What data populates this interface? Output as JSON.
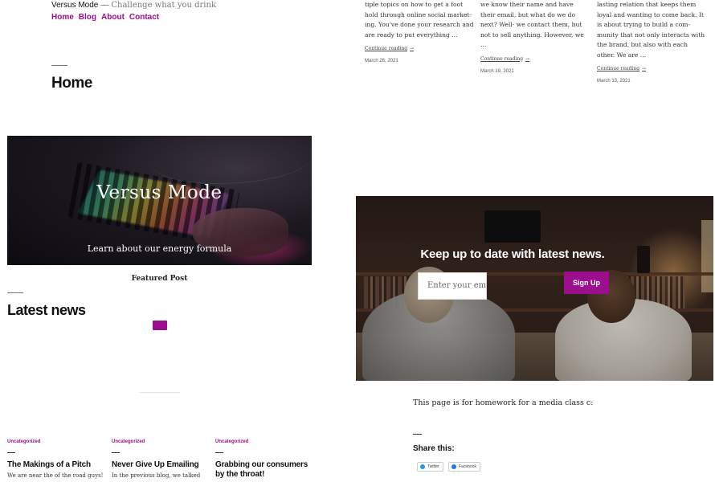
{
  "site": {
    "name": "Versus Mode",
    "dash": "—",
    "tagline": "Challenge what you drink"
  },
  "nav": {
    "items": [
      "Home",
      "Blog",
      "About",
      "Contact"
    ]
  },
  "page": {
    "title": "Home"
  },
  "hero": {
    "title": "Versus Mode",
    "subtitle": "Learn about our energy formula",
    "caption": "Featured Post"
  },
  "latest": {
    "title": "Latest news",
    "cards": [
      {
        "category": "Uncategorized",
        "title": "The Makings of a Pitch",
        "excerpt": "We are near the of the road guys!"
      },
      {
        "category": "Uncategorized",
        "title": "Never Give Up Emailing",
        "excerpt": "In the previous blog, we talked"
      },
      {
        "category": "Uncategorized",
        "title": "Grabbing our consumers by the throat!",
        "excerpt": ""
      }
    ]
  },
  "posts": [
    {
      "lines": [
        "tiple topics on how to get a foot",
        "hold through online social market-",
        "ing. You've done your research and",
        "are ready to put everything ..."
      ],
      "more": "Continue reading",
      "arrow": "→",
      "date": "March 26, 2021"
    },
    {
      "lines": [
        "we know their name and have",
        "their email, but what do we do",
        "next? Well- we contact them, but",
        "not to sell anything. However, we",
        "..."
      ],
      "more": "Continue reading",
      "arrow": "→",
      "date": "March 19, 2021"
    },
    {
      "lines": [
        "lasting relation that keeps them",
        "loyal and wanting to come back. It",
        "is about trying to build a com-",
        "munity that not only interacts with",
        "the brand, but also with each",
        "other. We are ..."
      ],
      "more": "Continue reading",
      "arrow": "→",
      "date": "March 13, 2021"
    }
  ],
  "newsletter": {
    "heading": "Keep up to date with latest news.",
    "email_placeholder": "Enter your email",
    "button": "Sign Up"
  },
  "footer": {
    "homework": "This page is for homework for a media class c:",
    "share_label": "Share this:",
    "share_buttons": [
      {
        "label": "Twitter",
        "icon": "twitter-icon",
        "color": "#1d9bf0"
      },
      {
        "label": "Facebook",
        "icon": "facebook-icon",
        "color": "#1877f2"
      }
    ]
  },
  "colors": {
    "accent": "#9b0e8c"
  }
}
